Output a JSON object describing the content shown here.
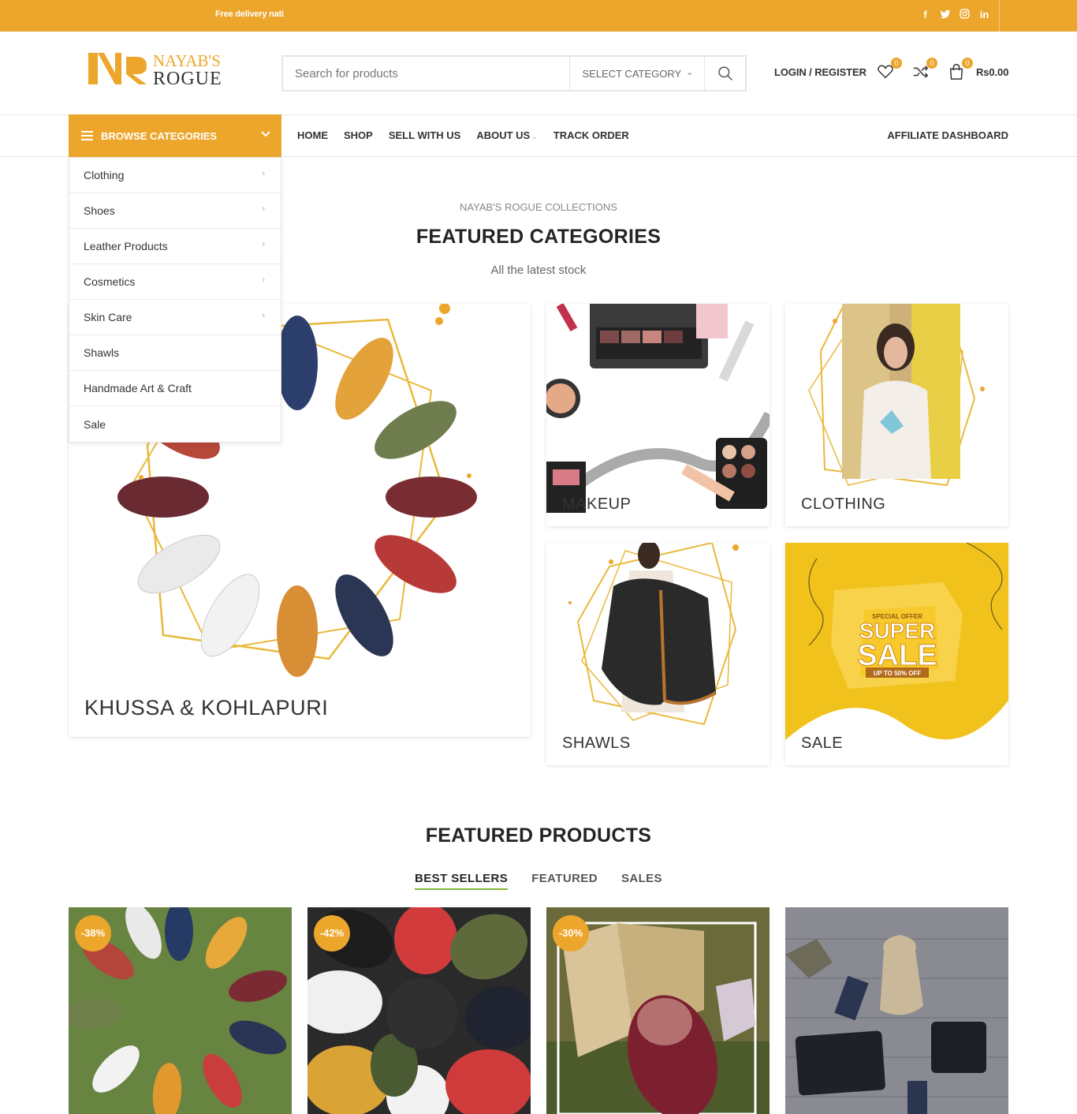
{
  "topbar": {
    "promo": "Free delivery nati",
    "socials": [
      "facebook-icon",
      "twitter-icon",
      "instagram-icon",
      "linkedin-icon"
    ]
  },
  "brand": {
    "line1": "NAYAB'S",
    "line2": "ROGUE",
    "monogram": "NR",
    "accent": "#eda62c"
  },
  "search": {
    "placeholder": "Search for products",
    "category": "SELECT CATEGORY"
  },
  "header": {
    "login": "LOGIN / REGISTER",
    "wishlist_count": "0",
    "compare_count": "0",
    "cart_count": "0",
    "cart_total": "Rs0.00"
  },
  "nav": {
    "browse": "BROWSE CATEGORIES",
    "items": [
      "HOME",
      "SHOP",
      "SELL WITH US",
      "ABOUT US",
      "TRACK ORDER"
    ],
    "affiliate": "AFFILIATE DASHBOARD"
  },
  "dropdown": [
    {
      "label": "Clothing",
      "arrow": true
    },
    {
      "label": "Shoes",
      "arrow": true
    },
    {
      "label": "Leather Products",
      "arrow": true
    },
    {
      "label": "Cosmetics",
      "arrow": true
    },
    {
      "label": "Skin Care",
      "arrow": true
    },
    {
      "label": "Shawls",
      "arrow": false
    },
    {
      "label": "Handmade Art & Craft",
      "arrow": false
    },
    {
      "label": "Sale",
      "arrow": false
    }
  ],
  "featured_categories": {
    "eyebrow": "NAYAB'S ROGUE COLLECTIONS",
    "title": "FEATURED CATEGORIES",
    "subtitle": "All the latest stock",
    "tiles": {
      "khussa": "KHUSSA & KOHLAPURI",
      "makeup": "MAKEUP",
      "clothing": "CLOTHING",
      "shawls": "SHAWLS",
      "sale": "SALE"
    },
    "sale_banner": {
      "special": "SPECIAL OFFER",
      "super": "SUPER",
      "sale": "SALE",
      "upto": "UP TO 50% OFF"
    }
  },
  "featured_products": {
    "title": "FEATURED PRODUCTS",
    "tabs": [
      "BEST SELLERS",
      "FEATURED",
      "SALES"
    ],
    "discounts": [
      "-38%",
      "-42%",
      "-30%"
    ]
  }
}
